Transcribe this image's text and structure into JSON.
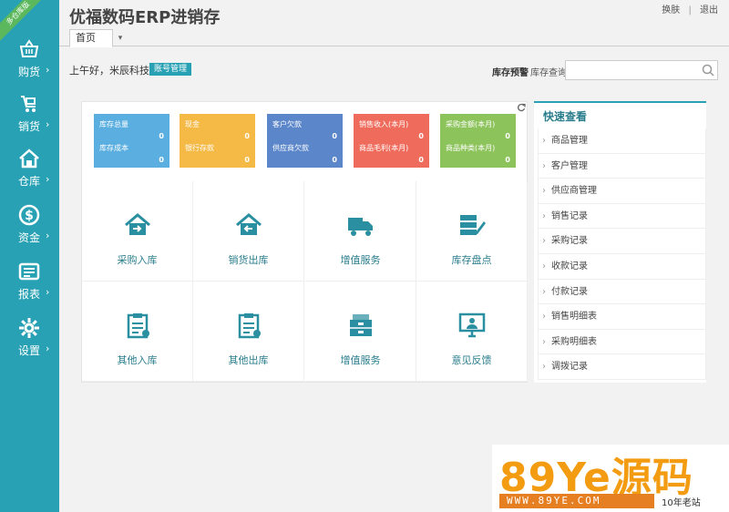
{
  "app": {
    "title": "优福数码ERP进销存",
    "ribbon": "多仓库版"
  },
  "top_links": {
    "switch": "换肤",
    "logout": "退出",
    "sep": "|"
  },
  "tabs": [
    {
      "label": "首页"
    }
  ],
  "greeting": {
    "text": "上午好，米辰科技",
    "account_button": "账号管理"
  },
  "search": {
    "stock_alert": "库存预警",
    "stock_query": "库存查询",
    "value": ""
  },
  "sidebar": {
    "items": [
      {
        "label": "购货",
        "arrow": "›"
      },
      {
        "label": "销货",
        "arrow": "›"
      },
      {
        "label": "仓库",
        "arrow": "›"
      },
      {
        "label": "资金",
        "arrow": "›"
      },
      {
        "label": "报表",
        "arrow": "›"
      },
      {
        "label": "设置",
        "arrow": "›"
      }
    ]
  },
  "stats": [
    {
      "color": "#5aaee0",
      "label1": "库存总量",
      "value1": "0",
      "label2": "库存成本",
      "value2": "0"
    },
    {
      "color": "#f5b945",
      "label1": "现金",
      "value1": "0",
      "label2": "银行存款",
      "value2": "0"
    },
    {
      "color": "#5b86c9",
      "label1": "客户欠款",
      "value1": "0",
      "label2": "供应商欠款",
      "value2": "0"
    },
    {
      "color": "#ef6c5c",
      "label1": "销售收入(本月)",
      "value1": "0",
      "label2": "商品毛利(本月)",
      "value2": "0"
    },
    {
      "color": "#8dc35b",
      "label1": "采购金额(本月)",
      "value1": "0",
      "label2": "商品种类(本月)",
      "value2": "0"
    }
  ],
  "tiles": [
    {
      "label": "采购入库",
      "icon": "house-in-icon"
    },
    {
      "label": "销货出库",
      "icon": "house-out-icon"
    },
    {
      "label": "增值服务",
      "icon": "truck-icon"
    },
    {
      "label": "库存盘点",
      "icon": "stack-edit-icon"
    },
    {
      "label": "其他入库",
      "icon": "clipboard-in-icon"
    },
    {
      "label": "其他出库",
      "icon": "clipboard-out-icon"
    },
    {
      "label": "增值服务",
      "icon": "cabinet-icon"
    },
    {
      "label": "意见反馈",
      "icon": "monitor-user-icon"
    }
  ],
  "quick_view": {
    "title": "快速查看",
    "items": [
      {
        "label": "商品管理"
      },
      {
        "label": "客户管理"
      },
      {
        "label": "供应商管理"
      },
      {
        "label": "销售记录"
      },
      {
        "label": "采购记录"
      },
      {
        "label": "收款记录"
      },
      {
        "label": "付款记录"
      },
      {
        "label": "销售明细表"
      },
      {
        "label": "采购明细表"
      },
      {
        "label": "调拨记录"
      }
    ]
  },
  "watermark": {
    "main": "89Ye源码",
    "sub": "WWW.89YE.COM",
    "tag": "10年老站"
  },
  "colors": {
    "sidebar": "#28a1b4",
    "accent": "#2a7d8c",
    "watermark": "#f39c12"
  }
}
